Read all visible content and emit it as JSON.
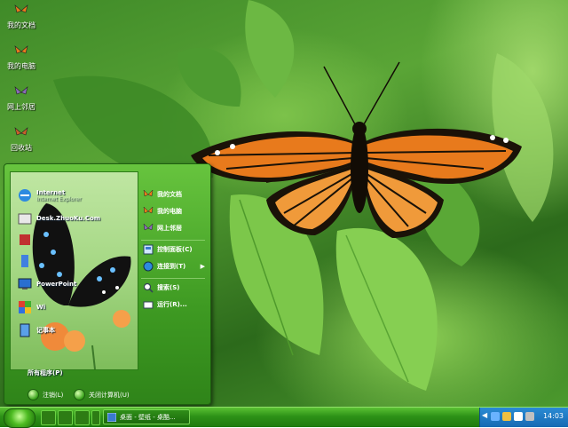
{
  "desktop": {
    "icons": [
      {
        "label": "我的文档",
        "icon": "butterfly-icon"
      },
      {
        "label": "我的电脑",
        "icon": "butterfly-icon"
      },
      {
        "label": "网上邻居",
        "icon": "butterfly-icon"
      },
      {
        "label": "回收站",
        "icon": "butterfly-icon"
      }
    ]
  },
  "start_menu": {
    "pinned": [
      {
        "label": "Internet",
        "sub": "Internet Explorer",
        "icon": "ie-icon"
      },
      {
        "label": "Desk.ZhuoKu.Com",
        "icon": "folder-icon"
      },
      {
        "label": "",
        "icon": "app-icon"
      },
      {
        "label": "",
        "icon": "app-icon"
      },
      {
        "label": "PowerPoint",
        "icon": "monitor-icon"
      },
      {
        "label": "Wi",
        "icon": "media-icon"
      },
      {
        "label": "记事本",
        "icon": "notepad-icon"
      }
    ],
    "all_programs": "所有程序(P)",
    "right_items": [
      {
        "label": "我的文档",
        "icon": "butterfly-icon"
      },
      {
        "label": "我的电脑",
        "icon": "butterfly-icon"
      },
      {
        "label": "网上邻居",
        "icon": "butterfly-icon"
      },
      {
        "label": "控制面板(C)",
        "icon": "control-panel-icon"
      },
      {
        "label": "连接到(T)",
        "icon": "globe-icon"
      },
      {
        "label": "搜索(S)",
        "icon": "search-icon"
      },
      {
        "label": "运行(R)...",
        "icon": "run-icon"
      }
    ],
    "logoff_label": "注销(L)",
    "shutdown_label": "关闭计算机(U)"
  },
  "taskbar": {
    "task_label": "桌面 - 壁纸 - 桌酷...",
    "clock": "14:03"
  },
  "colors": {
    "accent": "#3e9a22",
    "tray": "#176ab3"
  }
}
